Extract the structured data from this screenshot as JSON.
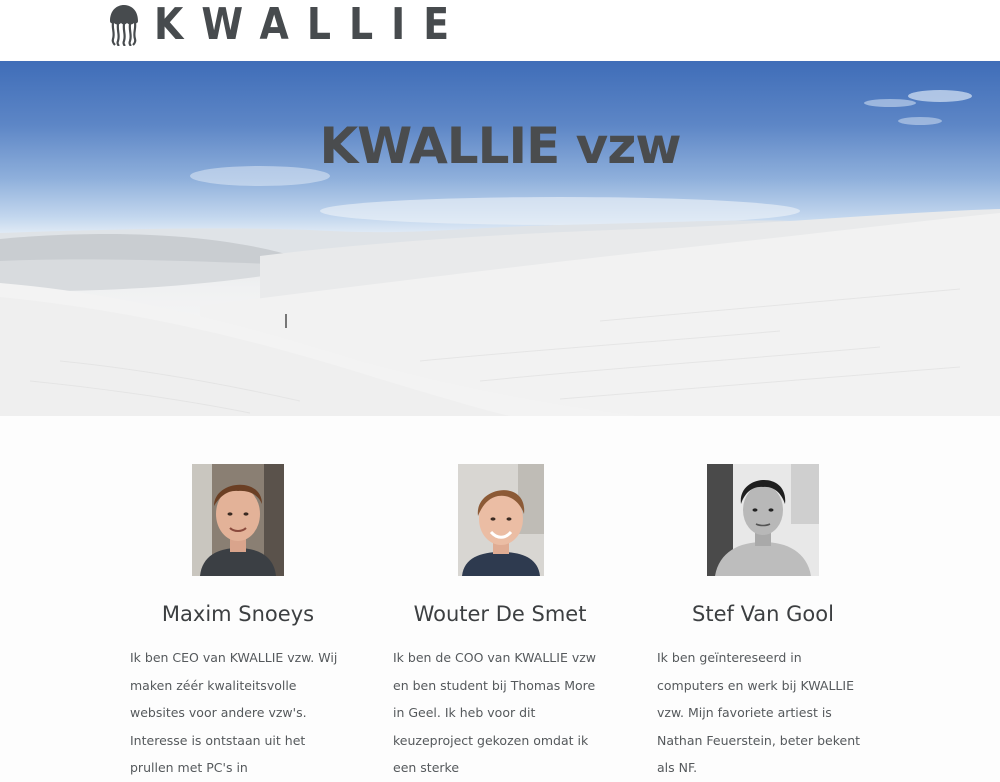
{
  "header": {
    "logo_text": "KWALLIE",
    "logo_icon": "jellyfish-icon"
  },
  "hero": {
    "title": "KWALLIE vzw"
  },
  "team": [
    {
      "name": "Maxim Snoeys",
      "photo": "portrait-photo",
      "bio": "Ik ben CEO van KWALLIE vzw. Wij maken zéér kwaliteitsvolle websites voor andere vzw's. Interesse is ontstaan uit het prullen met PC's in"
    },
    {
      "name": "Wouter De Smet",
      "photo": "portrait-photo",
      "bio": "Ik ben de COO van KWALLIE vzw en ben student bij Thomas More in Geel. Ik heb voor dit keuzeproject gekozen omdat ik een sterke"
    },
    {
      "name": "Stef Van Gool",
      "photo": "portrait-photo",
      "bio": "Ik ben geïntereseerd in computers en werk bij KWALLIE vzw. Mijn favoriete artiest is Nathan Feuerstein, beter bekent als NF."
    }
  ]
}
